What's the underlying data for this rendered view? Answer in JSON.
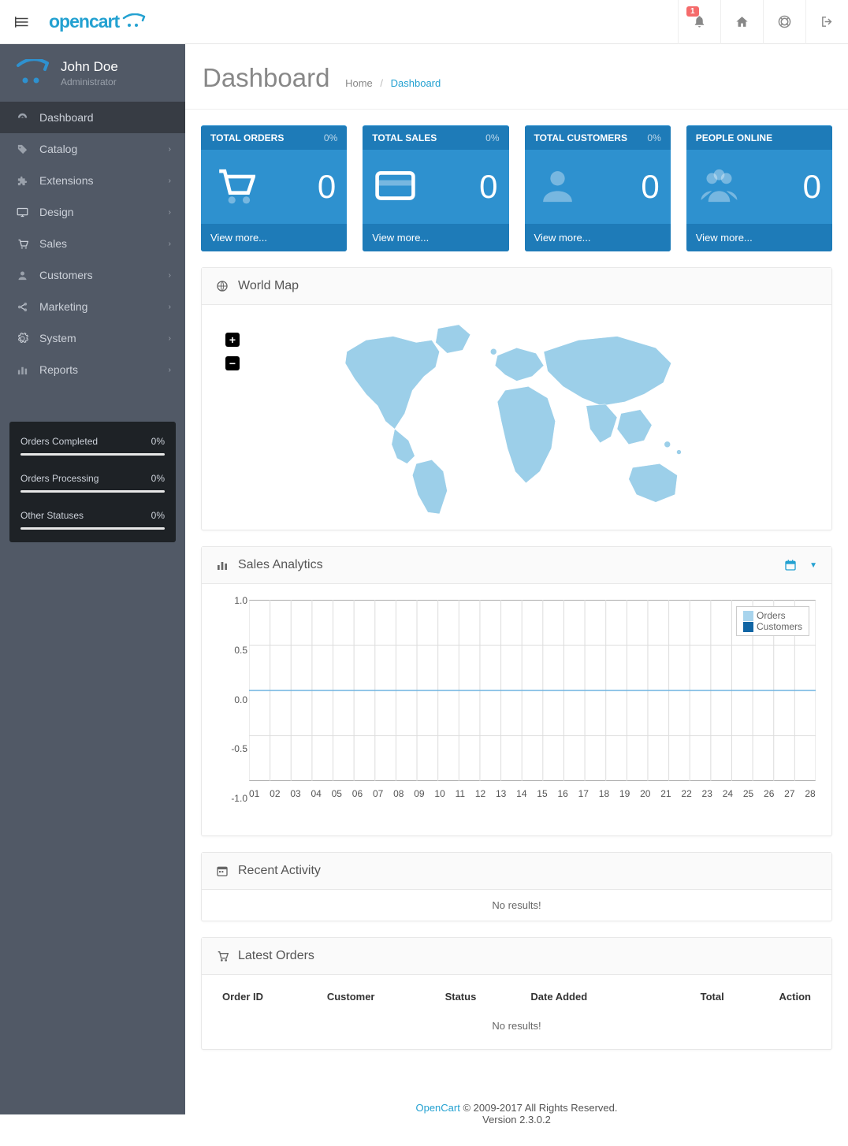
{
  "brand": "opencart",
  "notif_count": "1",
  "user": {
    "name": "John Doe",
    "role": "Administrator"
  },
  "nav": [
    {
      "label": "Dashboard",
      "active": true,
      "icon": "dashboard",
      "expandable": false
    },
    {
      "label": "Catalog",
      "icon": "tags",
      "expandable": true
    },
    {
      "label": "Extensions",
      "icon": "puzzle",
      "expandable": true
    },
    {
      "label": "Design",
      "icon": "desktop",
      "expandable": true
    },
    {
      "label": "Sales",
      "icon": "cart",
      "expandable": true
    },
    {
      "label": "Customers",
      "icon": "user",
      "expandable": true
    },
    {
      "label": "Marketing",
      "icon": "share",
      "expandable": true
    },
    {
      "label": "System",
      "icon": "gear",
      "expandable": true
    },
    {
      "label": "Reports",
      "icon": "chart",
      "expandable": true
    }
  ],
  "stats": [
    {
      "label": "Orders Completed",
      "value": "0%"
    },
    {
      "label": "Orders Processing",
      "value": "0%"
    },
    {
      "label": "Other Statuses",
      "value": "0%"
    }
  ],
  "page": {
    "title": "Dashboard",
    "crumb_home": "Home",
    "crumb_current": "Dashboard"
  },
  "tiles": [
    {
      "title": "TOTAL ORDERS",
      "pct": "0%",
      "value": "0",
      "more": "View more...",
      "icon": "cart"
    },
    {
      "title": "TOTAL SALES",
      "pct": "0%",
      "value": "0",
      "more": "View more...",
      "icon": "card"
    },
    {
      "title": "TOTAL CUSTOMERS",
      "pct": "0%",
      "value": "0",
      "more": "View more...",
      "icon": "user"
    },
    {
      "title": "PEOPLE ONLINE",
      "pct": "",
      "value": "0",
      "more": "View more...",
      "icon": "users"
    }
  ],
  "panels": {
    "world_map": "World Map",
    "sales_analytics": "Sales Analytics",
    "recent_activity": "Recent Activity",
    "latest_orders": "Latest Orders"
  },
  "map": {
    "zoom_in": "+",
    "zoom_out": "−"
  },
  "chart_data": {
    "type": "line",
    "title": "Sales Analytics",
    "xlabel": "",
    "ylabel": "",
    "ylim": [
      -1.0,
      1.0
    ],
    "yticks": [
      "1.0",
      "0.5",
      "0.0",
      "-0.5",
      "-1.0"
    ],
    "categories": [
      "01",
      "02",
      "03",
      "04",
      "05",
      "06",
      "07",
      "08",
      "09",
      "10",
      "11",
      "12",
      "13",
      "14",
      "15",
      "16",
      "17",
      "18",
      "19",
      "20",
      "21",
      "22",
      "23",
      "24",
      "25",
      "26",
      "27",
      "28"
    ],
    "series": [
      {
        "name": "Orders",
        "color": "#a8d4ed",
        "values": [
          0,
          0,
          0,
          0,
          0,
          0,
          0,
          0,
          0,
          0,
          0,
          0,
          0,
          0,
          0,
          0,
          0,
          0,
          0,
          0,
          0,
          0,
          0,
          0,
          0,
          0,
          0,
          0
        ]
      },
      {
        "name": "Customers",
        "color": "#1065a4",
        "values": [
          0,
          0,
          0,
          0,
          0,
          0,
          0,
          0,
          0,
          0,
          0,
          0,
          0,
          0,
          0,
          0,
          0,
          0,
          0,
          0,
          0,
          0,
          0,
          0,
          0,
          0,
          0,
          0
        ]
      }
    ]
  },
  "recent_activity_empty": "No results!",
  "orders_table": {
    "headers": [
      "Order ID",
      "Customer",
      "Status",
      "Date Added",
      "Total",
      "Action"
    ],
    "empty": "No results!"
  },
  "footer": {
    "brand": "OpenCart",
    "text": " © 2009-2017 All Rights Reserved.",
    "version": "Version 2.3.0.2"
  }
}
